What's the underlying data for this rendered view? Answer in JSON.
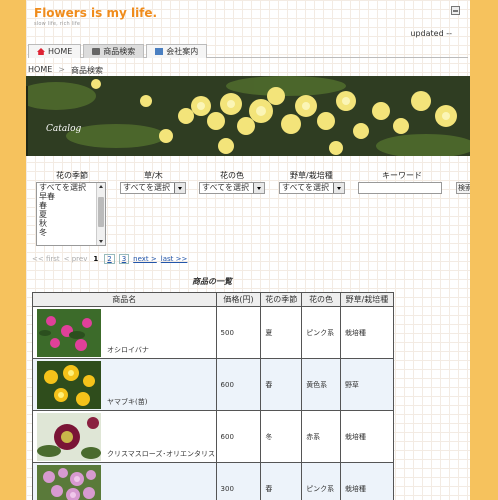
{
  "site": {
    "title": "Flowers is my life.",
    "subtitle": "slow life, rich life",
    "updated": "updated --"
  },
  "nav": {
    "tabs": [
      {
        "label": "HOME",
        "icon": "home-icon",
        "active": false
      },
      {
        "label": "商品検索",
        "icon": "cart-icon",
        "active": true
      },
      {
        "label": "会社案内",
        "icon": "document-icon",
        "active": false
      }
    ]
  },
  "breadcrumb": {
    "home": "HOME",
    "sep": ">",
    "current": "商品検索"
  },
  "banner": {
    "caption": "Catalog"
  },
  "filters": {
    "season_label": "花の季節",
    "season_options": [
      "すべてを選択",
      "早春",
      "春",
      "夏",
      "秋",
      "冬"
    ],
    "type_label": "草/木",
    "type_value": "すべてを選択",
    "color_label": "花の色",
    "color_value": "すべてを選択",
    "wild_label": "野草/栽培種",
    "wild_value": "すべてを選択",
    "keyword_label": "キーワード",
    "keyword_value": "",
    "search_button": "検索"
  },
  "pager": {
    "first": "<< first",
    "prev": "< prev",
    "current": "1",
    "pages": [
      "2",
      "3"
    ],
    "next": "next >",
    "last": "last >>"
  },
  "list": {
    "title": "商品の一覧",
    "columns": [
      "商品名",
      "価格(円)",
      "花の季節",
      "花の色",
      "野草/栽培種"
    ],
    "rows": [
      {
        "name": "オシロイバナ",
        "price": "500",
        "season": "夏",
        "color": "ピンク系",
        "kind": "栽培種"
      },
      {
        "name": "ヤマブキ(苗)",
        "price": "600",
        "season": "春",
        "color": "黄色系",
        "kind": "野草"
      },
      {
        "name": "クリスマスローズ･オリエンタリス",
        "price": "600",
        "season": "冬",
        "color": "赤系",
        "kind": "栽培種"
      },
      {
        "name": "",
        "price": "300",
        "season": "春",
        "color": "ピンク系",
        "kind": "栽培種"
      }
    ]
  },
  "colors": {
    "background": "#f6c25d",
    "title": "#f08c1c",
    "link": "#2255aa"
  }
}
